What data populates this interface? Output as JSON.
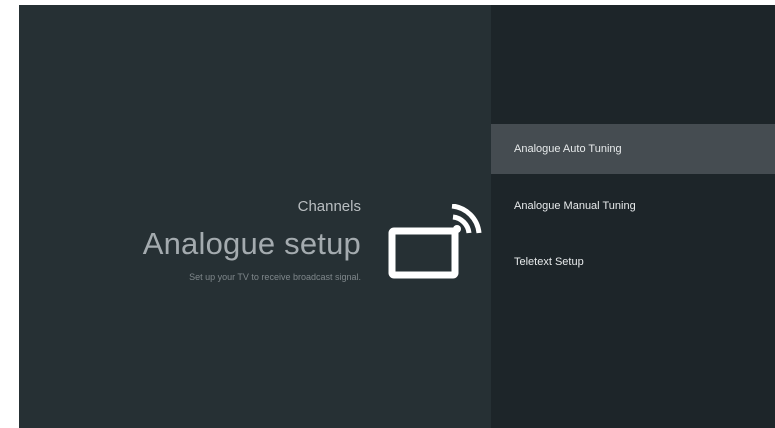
{
  "header": {
    "section": "Channels",
    "title": "Analogue setup",
    "subtitle": "Set up your TV to receive broadcast signal."
  },
  "icon": {
    "name": "tv-broadcast-icon",
    "color": "#ffffff"
  },
  "menu": {
    "items": [
      {
        "label": "Analogue Auto Tuning",
        "selected": true
      },
      {
        "label": "Analogue Manual Tuning",
        "selected": false
      },
      {
        "label": "Teletext Setup",
        "selected": false
      }
    ]
  },
  "colors": {
    "left_background": "#263034",
    "right_background": "#1d2529",
    "selected_background": "#454c51",
    "text_primary": "#e7eaeb"
  }
}
